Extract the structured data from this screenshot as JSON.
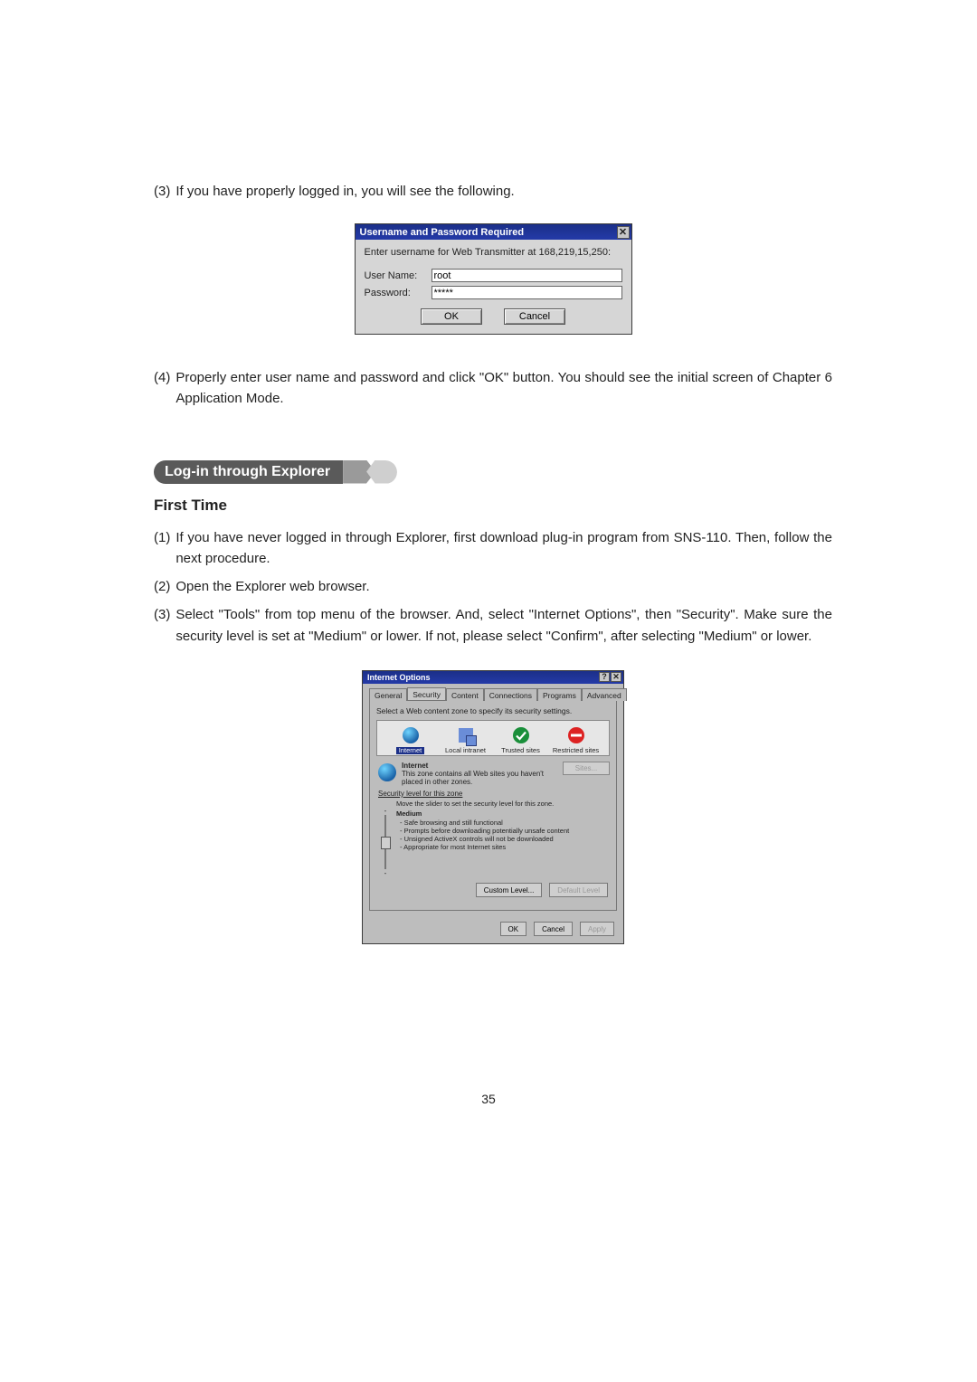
{
  "body": {
    "step3": "If you have properly logged in, you will see the following.",
    "step4": "Properly enter user name and password and click \"OK\" button.  You should see the initial screen of Chapter 6 Application Mode."
  },
  "dlg1": {
    "title": "Username and Password Required",
    "msg": "Enter username for Web Transmitter at 168,219,15,250:",
    "user_label": "User Name:",
    "user_value": "root",
    "pass_label": "Password:",
    "pass_value": "*****",
    "ok": "OK",
    "cancel": "Cancel"
  },
  "section_heading": "Log-in through Explorer",
  "subheading": "First Time",
  "explorer_steps": {
    "s1": "If you have never logged in through Explorer, first download plug-in program from SNS-110. Then, follow the next procedure.",
    "s2": "Open the Explorer web browser.",
    "s3": "Select \"Tools\" from top menu of the browser.  And, select \"Internet Options\", then \"Security\". Make sure the security level is set at \"Medium\" or lower.  If not, please select \"Confirm\", after selecting \"Medium\" or lower."
  },
  "dlg2": {
    "title": "Internet Options",
    "tabs": [
      "General",
      "Security",
      "Content",
      "Connections",
      "Programs",
      "Advanced"
    ],
    "instr": "Select a Web content zone to specify its security settings.",
    "zones": {
      "internet": "Internet",
      "intranet": "Local intranet",
      "trusted": "Trusted sites",
      "restricted": "Restricted sites"
    },
    "zone_desc_title": "Internet",
    "zone_desc_text": "This zone contains all Web sites you haven't placed in other zones.",
    "sites_btn": "Sites...",
    "sec_label": "Security level for this zone",
    "sec_move": "Move the slider to set the security level for this zone.",
    "sec_name": "Medium",
    "sec_bullets": [
      "Safe browsing and still functional",
      "Prompts before downloading potentially unsafe content",
      "Unsigned ActiveX controls will not be downloaded",
      "Appropriate for most Internet sites"
    ],
    "custom_level": "Custom Level...",
    "default_level": "Default Level",
    "ok": "OK",
    "cancel": "Cancel",
    "apply": "Apply"
  },
  "page_number": "35"
}
